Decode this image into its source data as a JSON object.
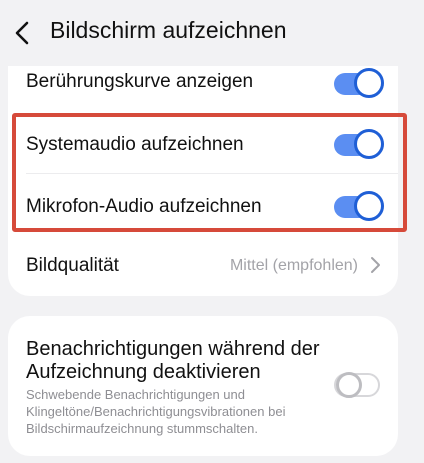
{
  "header": {
    "title": "Bildschirm aufzeichnen"
  },
  "settings": {
    "touch_curve_label": "Berührungskurve anzeigen",
    "touch_curve_on": true,
    "system_audio_label": "Systemaudio aufzeichnen",
    "system_audio_on": true,
    "mic_audio_label": "Mikrofon-Audio aufzeichnen",
    "mic_audio_on": true,
    "quality_label": "Bildqualität",
    "quality_value": "Mittel (empfohlen)"
  },
  "notifications": {
    "title": "Benachrichtigungen während der Aufzeichnung deaktivieren",
    "description": "Schwebende Benachrichtigungen und Klingeltöne/Benachrichtigungsvibrationen bei Bildschirmaufzeichnung stummschalten.",
    "enabled": false
  },
  "colors": {
    "accent": "#1f5fd6",
    "toggle_track_on": "#5b8ef2",
    "highlight": "#d64a3a",
    "background": "#f2f2f4"
  }
}
